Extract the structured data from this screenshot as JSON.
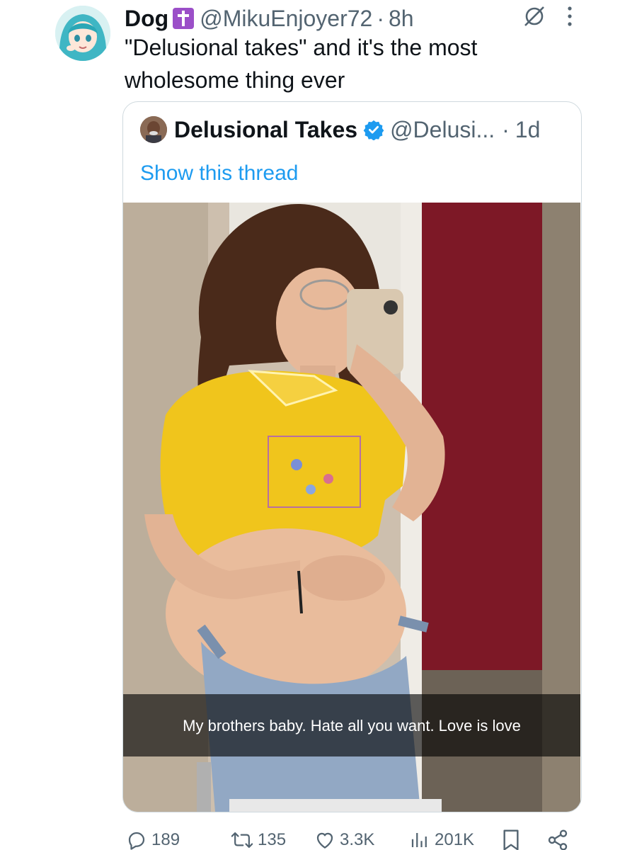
{
  "author": {
    "display_name": "Dog",
    "badge_icon": "latin-cross-icon",
    "badge_color": "#9b4fc8",
    "handle": "@MikuEnjoyer72",
    "separator": "·",
    "time": "8h"
  },
  "tweet": {
    "text": "\"Delusional takes\" and it's the most wholesome thing ever"
  },
  "quoted_tweet": {
    "display_name": "Delusional Takes",
    "verified_color": "#1d9bf0",
    "handle": "@Delusi...",
    "separator": "·",
    "time": "1d",
    "show_thread": "Show this thread",
    "caption": "My brothers baby. Hate all you want. Love is love"
  },
  "actions": {
    "replies": "189",
    "retweets": "135",
    "likes": "3.3K",
    "views": "201K"
  },
  "colors": {
    "text": "#0f1419",
    "secondary": "#536471",
    "link": "#1d9bf0",
    "border": "#cfd9de"
  }
}
